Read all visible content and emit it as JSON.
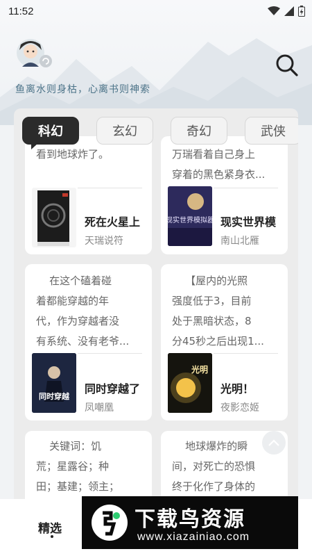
{
  "status_bar": {
    "time": "11:52",
    "icons": [
      "wifi-icon",
      "cell-signal-icon",
      "battery-icon"
    ]
  },
  "header": {
    "slogan": "鱼离水则身枯，心离书则神索",
    "avatar": "avatar-icon",
    "search_icon": "search-icon"
  },
  "tabs": [
    {
      "label": "科幻",
      "active": true
    },
    {
      "label": "玄幻",
      "active": false
    },
    {
      "label": "奇幻",
      "active": false
    },
    {
      "label": "武侠",
      "active": false
    }
  ],
  "books": [
    {
      "blurb": "看到地球炸了。",
      "title": "死在火星上",
      "author": "天瑞说符",
      "cover_color": "#2a2a2a"
    },
    {
      "blurb": "万瑞看着自己身上\n穿着的黑色紧身衣...",
      "title": "现实世界模",
      "author": "南山北雁",
      "cover_color": "#3a3270"
    },
    {
      "blurb": "    在这个磕着碰\n着都能穿越的年\n代，作为穿越者没\n有系统、没有老爷...",
      "title": "同时穿越了",
      "author": "凤嘲凰",
      "cover_color": "#1f2a44"
    },
    {
      "blurb": "    【屋内的光照\n强度低于3，目前\n处于黑暗状态，8\n分45秒之后出现1...",
      "title": "光明！",
      "author": "夜影恋姬",
      "cover_color": "#1c1a10"
    },
    {
      "blurb": "    关键词：饥\n荒；星露谷；种\n田；基建；领主；",
      "title": "",
      "author": "",
      "cover_color": "#ffffff"
    },
    {
      "blurb": "    地球爆炸的瞬\n间，对死亡的恐惧\n终于化作了身体的",
      "title": "",
      "author": "",
      "cover_color": "#ffffff"
    }
  ],
  "cover_texts": {
    "book2_cover": "现实世界模拟器",
    "book3_cover": "同时穿越",
    "book4_cover": "光明"
  },
  "bottom_nav": {
    "featured_label": "精选"
  },
  "watermark": {
    "title": "下载鸟资源",
    "url": "www.xiazainiao.com"
  }
}
